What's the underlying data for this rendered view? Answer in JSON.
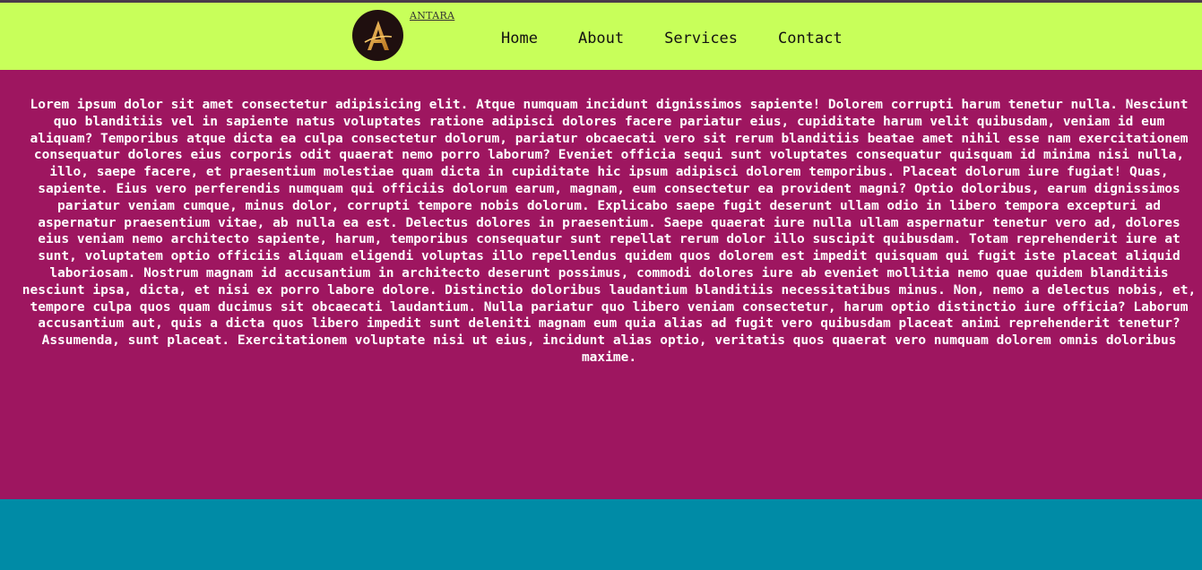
{
  "brand": {
    "name": "ANTARA",
    "logo_icon": "antara-a-logo-icon",
    "logo_letter": "A"
  },
  "nav": {
    "items": [
      "Home",
      "About",
      "Services",
      "Contact"
    ]
  },
  "content": {
    "paragraph": "Lorem ipsum dolor sit amet consectetur adipisicing elit. Atque numquam incidunt dignissimos sapiente! Dolorem corrupti harum tenetur nulla. Nesciunt quo blanditiis vel in sapiente natus voluptates ratione adipisci dolores facere pariatur eius, cupiditate harum velit quibusdam, veniam id eum aliquam? Temporibus atque dicta ea culpa consectetur dolorum, pariatur obcaecati vero sit rerum blanditiis beatae amet nihil esse nam exercitationem consequatur dolores eius corporis odit quaerat nemo porro laborum? Eveniet officia sequi sunt voluptates consequatur quisquam id minima nisi nulla, illo, saepe facere, et praesentium molestiae quam dicta in cupiditate hic ipsum adipisci dolorem temporibus. Placeat dolorum iure fugiat! Quas, sapiente. Eius vero perferendis numquam qui officiis dolorum earum, magnam, eum consectetur ea provident magni? Optio doloribus, earum dignissimos pariatur veniam cumque, minus dolor, corrupti tempore nobis dolorum. Explicabo saepe fugit deserunt ullam odio in libero tempora excepturi ad aspernatur praesentium vitae, ab nulla ea est. Delectus dolores in praesentium. Saepe quaerat iure nulla ullam aspernatur tenetur vero ad, dolores eius veniam nemo architecto sapiente, harum, temporibus consequatur sunt repellat rerum dolor illo suscipit quibusdam. Totam reprehenderit iure at sunt, voluptatem optio officiis aliquam eligendi voluptas illo repellendus quidem quos dolorem est impedit quisquam qui fugit iste placeat aliquid laboriosam. Nostrum magnam id accusantium in architecto deserunt possimus, commodi dolores iure ab eveniet mollitia nemo quae quidem blanditiis nesciunt ipsa, dicta, et nisi ex porro labore dolore. Distinctio doloribus laudantium blanditiis necessitatibus minus. Non, nemo a delectus nobis, et, tempore culpa quos quam ducimus sit obcaecati laudantium. Nulla pariatur quo libero veniam consectetur, harum optio distinctio iure officia? Laborum accusantium aut, quis a dicta quos libero impedit sunt deleniti magnam eum quia alias ad fugit vero quibusdam placeat animi reprehenderit tenetur? Assumenda, sunt placeat. Exercitationem voluptate nisi ut eius, incidunt alias optio, veritatis quos quaerat vero numquam dolorem omnis doloribus maxime."
  },
  "colors": {
    "navbar_bg": "#c8ff5a",
    "content_bg": "#9e1660",
    "footer_bg": "#008ba6",
    "logo_bg": "#1f0f0f",
    "logo_gold": "#e0a040",
    "text_light": "#ffffff"
  }
}
